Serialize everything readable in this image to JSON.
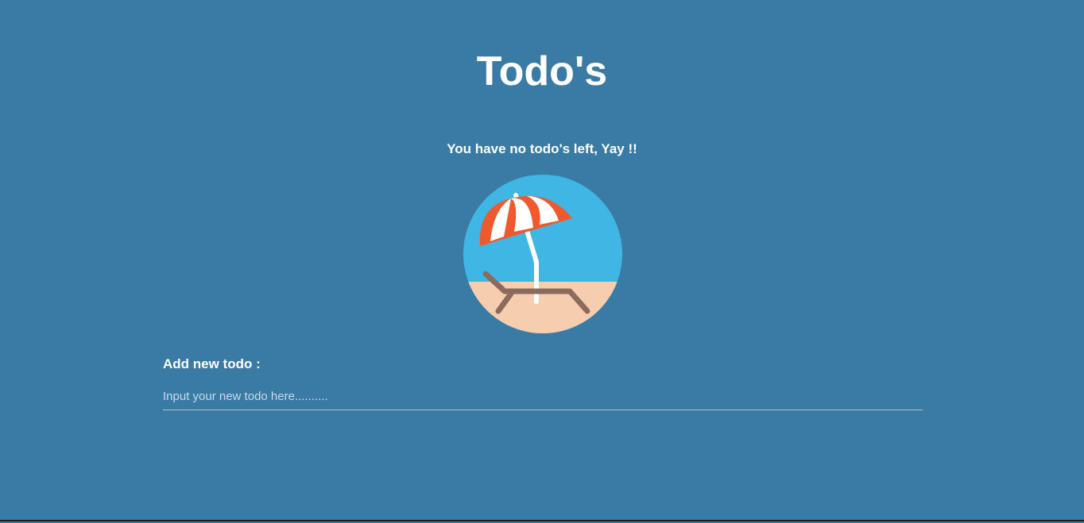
{
  "header": {
    "title": "Todo's"
  },
  "empty_state": {
    "message": "You have no todo's left, Yay !!",
    "illustration_icon": "beach-umbrella-lounger-icon"
  },
  "add_todo": {
    "label": "Add new todo :",
    "placeholder": "Input your new todo here..........",
    "value": ""
  },
  "colors": {
    "background": "#3a7ba5",
    "sky": "#3fb6e3",
    "sand": "#f7cdb0",
    "umbrella_red": "#ee5a2d",
    "umbrella_white": "#ffffff",
    "lounger": "#8c6a5d"
  }
}
